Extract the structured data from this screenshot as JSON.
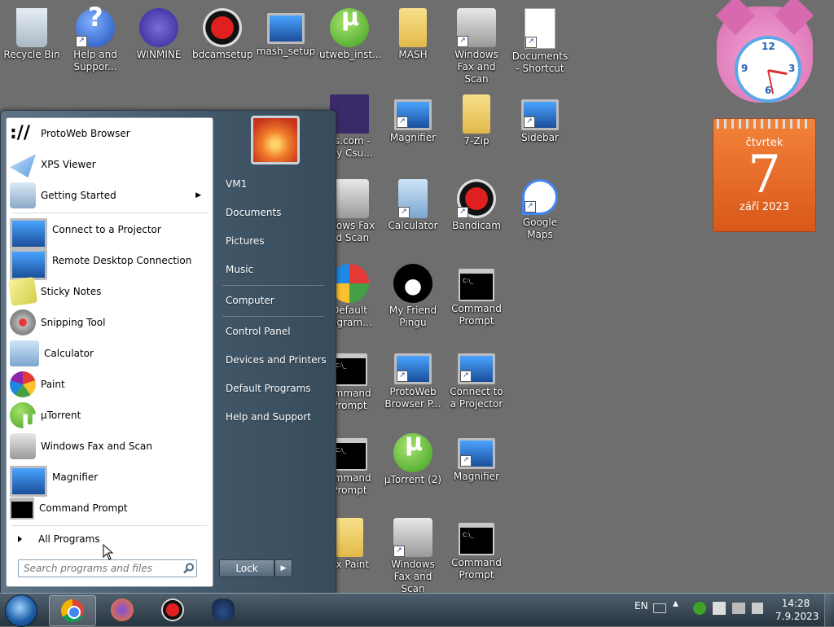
{
  "desktop": {
    "icons_row1": [
      {
        "label": "Recycle Bin",
        "icon": "recycle-bin-icon"
      },
      {
        "label": "Help and Suppor...",
        "icon": "help-icon"
      },
      {
        "label": "WINMINE",
        "icon": "minesweeper-icon"
      },
      {
        "label": "bdcamsetup",
        "icon": "installer-icon"
      },
      {
        "label": "mash_setup",
        "icon": "setup-icon"
      },
      {
        "label": "utweb_inst...",
        "icon": "utorrent-icon"
      },
      {
        "label": "MASH",
        "icon": "folder-icon"
      },
      {
        "label": "Windows Fax and Scan",
        "icon": "fax-icon"
      },
      {
        "label": "Documents - Shortcut",
        "icon": "document-icon"
      }
    ],
    "icons_col_a": [
      {
        "label": "1s.com - sky Csu...",
        "icon": "video-icon"
      },
      {
        "label": "ndows Fax nd Scan",
        "icon": "fax-icon"
      },
      {
        "label": "Default rogram...",
        "icon": "default-programs-icon"
      },
      {
        "label": "ommand Prompt",
        "icon": "cmd-icon"
      },
      {
        "label": "ommand Prompt",
        "icon": "cmd-icon"
      },
      {
        "label": "ux Paint",
        "icon": "folder-icon"
      }
    ],
    "icons_col_b": [
      {
        "label": "Magnifier",
        "icon": "magnifier-icon"
      },
      {
        "label": "Calculator",
        "icon": "calculator-icon"
      },
      {
        "label": "My Friend Pingu",
        "icon": "pingu-icon"
      },
      {
        "label": "ProtoWeb Browser P...",
        "icon": "protoweb-icon"
      },
      {
        "label": "µTorrent (2)",
        "icon": "utorrent-icon"
      },
      {
        "label": "Windows Fax and Scan",
        "icon": "fax-icon"
      }
    ],
    "icons_col_c": [
      {
        "label": "7-Zip",
        "icon": "folder-icon"
      },
      {
        "label": "Bandicam",
        "icon": "bandicam-icon"
      },
      {
        "label": "Command Prompt",
        "icon": "cmd-icon"
      },
      {
        "label": "Connect to a Projector",
        "icon": "projector-icon"
      },
      {
        "label": "Magnifier",
        "icon": "magnifier-icon"
      },
      {
        "label": "Command Prompt",
        "icon": "cmd-icon"
      }
    ],
    "icons_col_d": [
      {
        "label": "Sidebar",
        "icon": "sidebar-icon"
      },
      {
        "label": "Google Maps",
        "icon": "google-maps-icon"
      }
    ]
  },
  "gadgets": {
    "clock": {
      "num12": "12",
      "num3": "3",
      "num6": "6",
      "num9": "9"
    },
    "calendar": {
      "day_name": "čtvrtek",
      "day": "7",
      "month_year": "září 2023"
    }
  },
  "start_menu": {
    "programs": [
      {
        "label": "ProtoWeb Browser",
        "icon": "protoweb-icon"
      },
      {
        "label": "XPS Viewer",
        "icon": "xps-viewer-icon"
      },
      {
        "label": "Getting Started",
        "icon": "getting-started-icon",
        "submenu": "▶"
      },
      {
        "label": "Connect to a Projector",
        "icon": "projector-icon"
      },
      {
        "label": "Remote Desktop Connection",
        "icon": "remote-desktop-icon"
      },
      {
        "label": "Sticky Notes",
        "icon": "sticky-notes-icon"
      },
      {
        "label": "Snipping Tool",
        "icon": "snipping-tool-icon"
      },
      {
        "label": "Calculator",
        "icon": "calculator-icon"
      },
      {
        "label": "Paint",
        "icon": "paint-icon"
      },
      {
        "label": "µTorrent",
        "icon": "utorrent-icon"
      },
      {
        "label": "Windows Fax and Scan",
        "icon": "fax-icon"
      },
      {
        "label": "Magnifier",
        "icon": "magnifier-icon"
      },
      {
        "label": "Command Prompt",
        "icon": "cmd-icon"
      }
    ],
    "all_programs": "All Programs",
    "search_placeholder": "Search programs and files",
    "right_links": [
      "VM1",
      "Documents",
      "Pictures",
      "Music",
      "Computer",
      "Control Panel",
      "Devices and Printers",
      "Default Programs",
      "Help and Support"
    ],
    "lock_label": "Lock",
    "lock_arrow": "▶"
  },
  "taskbar": {
    "language": "EN",
    "time": "14:28",
    "date": "7.9.2023"
  }
}
